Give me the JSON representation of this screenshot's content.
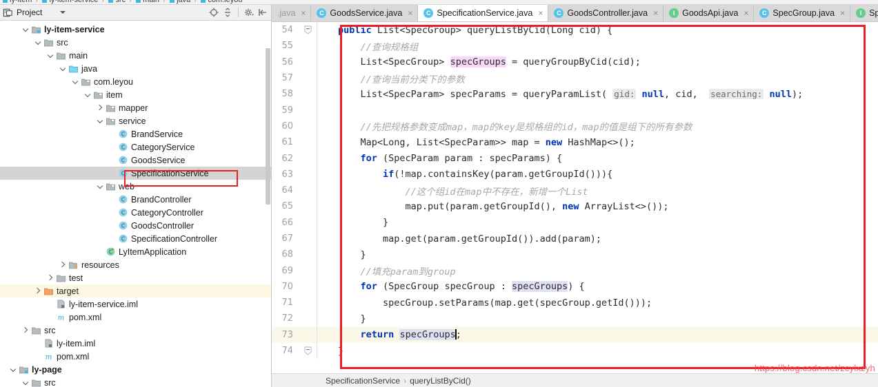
{
  "navbar": {
    "items": [
      "ly-item",
      "ly-item-service",
      "src",
      "main",
      "java",
      "com.leyou"
    ]
  },
  "project_panel": {
    "title": "Project",
    "icons": {
      "panel": "project-icon",
      "dropdown": "chevron-down-icon",
      "locate": "locate-target-icon",
      "collapse_all": "collapse-all-icon",
      "settings": "gear-icon",
      "hide": "hide-panel-icon"
    },
    "tree": [
      {
        "label": "ly-item-service",
        "icon": "module-folder-icon",
        "arrow": "down",
        "indent": 1,
        "bold": true,
        "state": "normal"
      },
      {
        "label": "src",
        "icon": "folder-icon",
        "arrow": "down",
        "indent": 2,
        "bold": false,
        "state": "normal"
      },
      {
        "label": "main",
        "icon": "folder-icon",
        "arrow": "down",
        "indent": 3,
        "bold": false,
        "state": "normal"
      },
      {
        "label": "java",
        "icon": "source-folder-icon",
        "arrow": "down",
        "indent": 4,
        "bold": false,
        "state": "normal"
      },
      {
        "label": "com.leyou",
        "icon": "package-icon",
        "arrow": "down",
        "indent": 5,
        "bold": false,
        "state": "normal"
      },
      {
        "label": "item",
        "icon": "package-icon",
        "arrow": "down",
        "indent": 6,
        "bold": false,
        "state": "normal"
      },
      {
        "label": "mapper",
        "icon": "package-icon",
        "arrow": "right",
        "indent": 7,
        "bold": false,
        "state": "normal"
      },
      {
        "label": "service",
        "icon": "package-icon",
        "arrow": "down",
        "indent": 7,
        "bold": false,
        "state": "normal"
      },
      {
        "label": "BrandService",
        "icon": "class-icon",
        "arrow": "none",
        "indent": 8,
        "bold": false,
        "state": "normal"
      },
      {
        "label": "CategoryService",
        "icon": "class-icon",
        "arrow": "none",
        "indent": 8,
        "bold": false,
        "state": "normal"
      },
      {
        "label": "GoodsService",
        "icon": "class-icon",
        "arrow": "none",
        "indent": 8,
        "bold": false,
        "state": "normal"
      },
      {
        "label": "SpecificationService",
        "icon": "class-icon",
        "arrow": "none",
        "indent": 8,
        "bold": false,
        "state": "selected"
      },
      {
        "label": "web",
        "icon": "package-icon",
        "arrow": "down",
        "indent": 7,
        "bold": false,
        "state": "normal"
      },
      {
        "label": "BrandController",
        "icon": "class-icon",
        "arrow": "none",
        "indent": 8,
        "bold": false,
        "state": "normal"
      },
      {
        "label": "CategoryController",
        "icon": "class-icon",
        "arrow": "none",
        "indent": 8,
        "bold": false,
        "state": "normal"
      },
      {
        "label": "GoodsController",
        "icon": "class-icon",
        "arrow": "none",
        "indent": 8,
        "bold": false,
        "state": "normal"
      },
      {
        "label": "SpecificationController",
        "icon": "class-icon",
        "arrow": "none",
        "indent": 8,
        "bold": false,
        "state": "normal"
      },
      {
        "label": "LyItemApplication",
        "icon": "spring-class-icon",
        "arrow": "none",
        "indent": 7,
        "bold": false,
        "state": "normal"
      },
      {
        "label": "resources",
        "icon": "resources-folder-icon",
        "arrow": "right",
        "indent": 4,
        "bold": false,
        "state": "normal"
      },
      {
        "label": "test",
        "icon": "folder-icon",
        "arrow": "right",
        "indent": 3,
        "bold": false,
        "state": "normal"
      },
      {
        "label": "target",
        "icon": "target-folder-icon",
        "arrow": "right",
        "indent": 2,
        "bold": false,
        "state": "highlighted"
      },
      {
        "label": "ly-item-service.iml",
        "icon": "iml-file-icon",
        "arrow": "none",
        "indent": 3,
        "bold": false,
        "state": "normal"
      },
      {
        "label": "pom.xml",
        "icon": "maven-icon",
        "arrow": "none",
        "indent": 3,
        "bold": false,
        "state": "normal"
      },
      {
        "label": "src",
        "icon": "folder-icon",
        "arrow": "right",
        "indent": 1,
        "bold": false,
        "state": "normal"
      },
      {
        "label": "ly-item.iml",
        "icon": "iml-file-icon",
        "arrow": "none",
        "indent": 2,
        "bold": false,
        "state": "normal"
      },
      {
        "label": "pom.xml",
        "icon": "maven-icon",
        "arrow": "none",
        "indent": 2,
        "bold": false,
        "state": "normal"
      },
      {
        "label": "ly-page",
        "icon": "module-folder-icon",
        "arrow": "down",
        "indent": 0,
        "bold": true,
        "state": "normal"
      },
      {
        "label": "src",
        "icon": "folder-icon",
        "arrow": "down",
        "indent": 1,
        "bold": false,
        "state": "normal"
      }
    ]
  },
  "editor": {
    "tabs": [
      {
        "label": ".java",
        "icon": "class-icon",
        "active": false,
        "clipped": true
      },
      {
        "label": "GoodsService.java",
        "icon": "class-icon",
        "active": false,
        "clipped": false
      },
      {
        "label": "SpecificationService.java",
        "icon": "class-icon",
        "active": true,
        "clipped": false
      },
      {
        "label": "GoodsController.java",
        "icon": "class-icon",
        "active": false,
        "clipped": false
      },
      {
        "label": "GoodsApi.java",
        "icon": "interface-icon",
        "active": false,
        "clipped": false
      },
      {
        "label": "SpecGroup.java",
        "icon": "class-icon",
        "active": false,
        "clipped": false
      },
      {
        "label": "Spe",
        "icon": "interface-icon",
        "active": false,
        "clipped": false
      }
    ],
    "close_glyph": "×",
    "first_line_number": 54,
    "lines": [
      {
        "n": 54,
        "fold": "collapse",
        "caret": false
      },
      {
        "n": 55,
        "fold": "none",
        "caret": false
      },
      {
        "n": 56,
        "fold": "none",
        "caret": false
      },
      {
        "n": 57,
        "fold": "none",
        "caret": false
      },
      {
        "n": 58,
        "fold": "none",
        "caret": false
      },
      {
        "n": 59,
        "fold": "none",
        "caret": false
      },
      {
        "n": 60,
        "fold": "none",
        "caret": false
      },
      {
        "n": 61,
        "fold": "none",
        "caret": false
      },
      {
        "n": 62,
        "fold": "none",
        "caret": false
      },
      {
        "n": 63,
        "fold": "none",
        "caret": false
      },
      {
        "n": 64,
        "fold": "none",
        "caret": false
      },
      {
        "n": 65,
        "fold": "none",
        "caret": false
      },
      {
        "n": 66,
        "fold": "none",
        "caret": false
      },
      {
        "n": 67,
        "fold": "none",
        "caret": false
      },
      {
        "n": 68,
        "fold": "none",
        "caret": false
      },
      {
        "n": 69,
        "fold": "none",
        "caret": false
      },
      {
        "n": 70,
        "fold": "none",
        "caret": false
      },
      {
        "n": 71,
        "fold": "none",
        "caret": false
      },
      {
        "n": 72,
        "fold": "none",
        "caret": false
      },
      {
        "n": 73,
        "fold": "none",
        "caret": true
      },
      {
        "n": 74,
        "fold": "collapse",
        "caret": false
      }
    ],
    "source_text": [
      "public List<SpecGroup> queryListByCid(Long cid) {",
      "    //查询规格组",
      "    List<SpecGroup> specGroups = queryGroupByCid(cid);",
      "    //查询当前分类下的参数",
      "    List<SpecParam> specParams = queryParamList( gid: null, cid,  searching: null);",
      "",
      "    //先把规格参数变成map，map的key是规格组的id，map的值是组下的所有参数",
      "    Map<Long, List<SpecParam>> map = new HashMap<>();",
      "    for (SpecParam param : specParams) {",
      "        if(!map.containsKey(param.getGroupId())){",
      "            //这个组id在map中不存在，新增一个List",
      "            map.put(param.getGroupId(), new ArrayList<>());",
      "        }",
      "        map.get(param.getGroupId()).add(param);",
      "    }",
      "    //填充param到group",
      "    for (SpecGroup specGroup : specGroups) {",
      "        specGroup.setParams(map.get(specGroup.getId()));",
      "    }",
      "    return specGroups;",
      "}"
    ],
    "parameter_hints": [
      "gid:",
      "searching:"
    ],
    "highlighted_identifier": "specGroups",
    "breadcrumb": {
      "class": "SpecificationService",
      "method": "queryListByCid()",
      "separator": "›"
    }
  },
  "annotations": {
    "tree_highlight_box": "red-rectangle-around-specification-service",
    "code_highlight_box": "red-rectangle-around-method-body"
  },
  "watermark": {
    "text": "https://blog.csdn.net/zcylxzyh"
  },
  "colors": {
    "accent_red": "#ee1c25",
    "keyword_blue": "#0033b3",
    "comment_gray": "#a8a8a8",
    "class_icon": "#58c3e8",
    "interface_icon": "#66cc8a",
    "selection_gray": "#d4d4d4",
    "caret_row_yellow": "#fcf8e8",
    "identifier_highlight": "#dfe1f5",
    "write_highlight": "#f8d8f8"
  }
}
